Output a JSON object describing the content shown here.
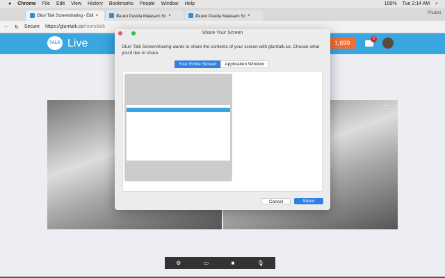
{
  "menubar": {
    "app": "Chrome",
    "items": [
      "File",
      "Edit",
      "View",
      "History",
      "Bookmarks",
      "People",
      "Window",
      "Help"
    ],
    "battery": "100%",
    "clock": "Tue 2:14 AM"
  },
  "tabs": [
    {
      "label": "Glurr Talk Screensharing - Edit"
    },
    {
      "label": "คือเคย Pavida Malasarn Sc"
    },
    {
      "label": "คือเคย Pavida Malasarn Sc"
    }
  ],
  "profile_name": "Phubet",
  "address": {
    "secure": "Secure",
    "url_host": "https://glurrtalk.co",
    "url_path": "/room/talk"
  },
  "header": {
    "logo": "TALK",
    "title": "Live",
    "coins": "1,699",
    "notifications": "0"
  },
  "dialog": {
    "title": "Share Your Screen",
    "description": "Glurr Talk Screensharing wants to share the contents of your screen with glurrtalk.co. Choose what you'd like to share.",
    "tabs": [
      "Your Entire Screen",
      "Application Window"
    ],
    "cancel": "Cancel",
    "share": "Share"
  },
  "toolbar": {
    "icons": [
      "gear-icon",
      "screen-share-icon",
      "camera-icon",
      "microphone-icon"
    ]
  }
}
